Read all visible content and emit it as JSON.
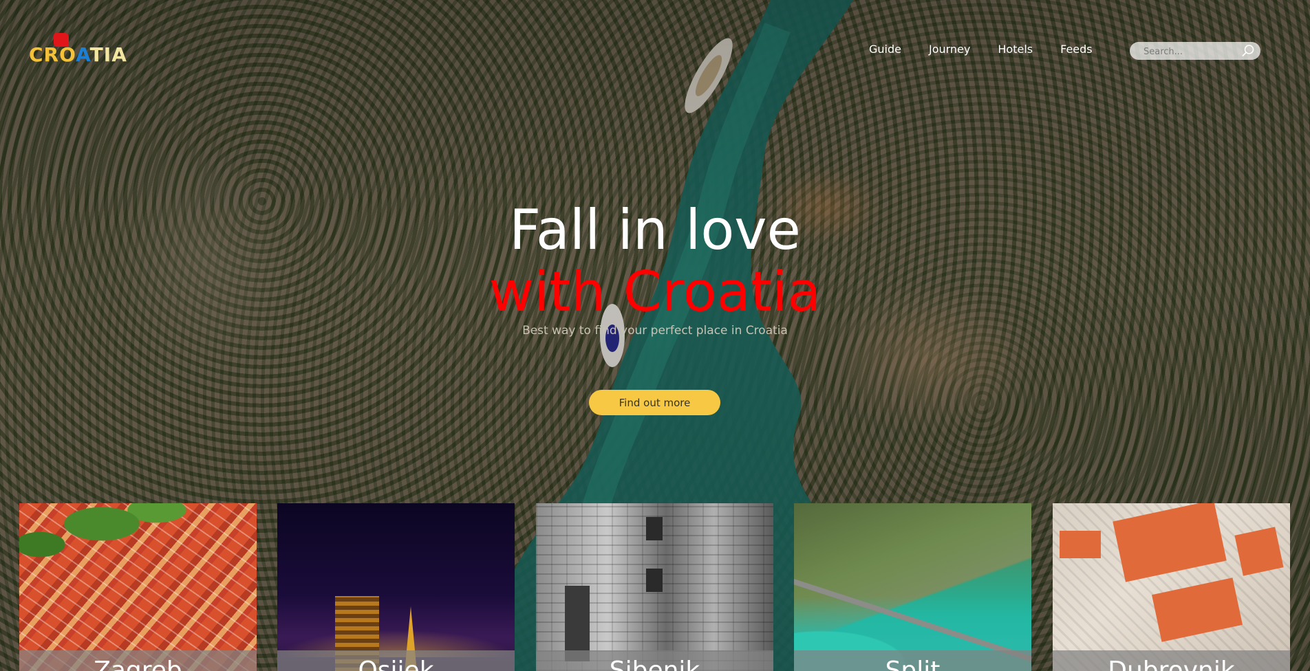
{
  "brand": {
    "logo_text_1": "CRO",
    "logo_text_2": "A",
    "logo_text_3": "TIA"
  },
  "nav": {
    "items": [
      {
        "label": "Guide"
      },
      {
        "label": "Journey"
      },
      {
        "label": "Hotels"
      },
      {
        "label": "Feeds"
      }
    ]
  },
  "search": {
    "placeholder": "Search..."
  },
  "hero": {
    "line1": "Fall in love",
    "line2": "with Croatia",
    "subtitle": "Best way to find your perfect place in Croatia",
    "cta_label": "Find out more"
  },
  "cities": [
    {
      "name": "Zagreb"
    },
    {
      "name": "Osijek"
    },
    {
      "name": "Sibenik"
    },
    {
      "name": "Split"
    },
    {
      "name": "Dubrovnik"
    }
  ],
  "colors": {
    "accent_red": "#ff0000",
    "cta_yellow": "#f6c843"
  }
}
